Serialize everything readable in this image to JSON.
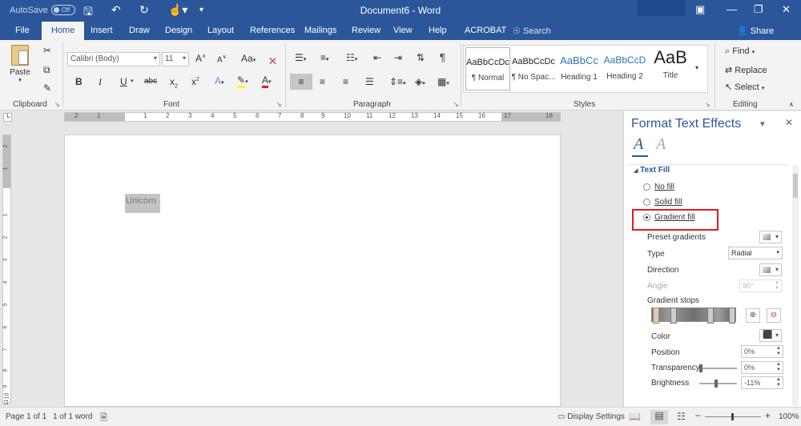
{
  "titlebar": {
    "autosave_label": "AutoSave",
    "autosave_state": "Off",
    "title": "Document6  -  Word",
    "qat_icons": [
      "save-icon",
      "undo-icon",
      "redo-icon",
      "touch-mode-icon",
      "customize-qat-icon"
    ]
  },
  "tabs": [
    "File",
    "Home",
    "Insert",
    "Draw",
    "Design",
    "Layout",
    "References",
    "Mailings",
    "Review",
    "View",
    "Help",
    "ACROBAT"
  ],
  "active_tab": "Home",
  "search_label": "Search",
  "share_label": "Share",
  "clipboard": {
    "paste": "Paste",
    "group": "Clipboard"
  },
  "font": {
    "name": "Calibri (Body)",
    "size": "11",
    "group": "Font",
    "grow": "A",
    "shrink": "A",
    "case": "Aa",
    "bold": "B",
    "italic": "I",
    "underline": "U",
    "strike": "abc",
    "subscript": "x",
    "superscript": "x",
    "effects": "A",
    "color": "A"
  },
  "paragraph": {
    "group": "Paragraph",
    "pilcrow": "¶"
  },
  "styles": {
    "group": "Styles",
    "items": [
      {
        "sample": "AaBbCcDc",
        "name": "¶ Normal"
      },
      {
        "sample": "AaBbCcDc",
        "name": "¶ No Spac..."
      },
      {
        "sample": "AaBbCc",
        "name": "Heading 1"
      },
      {
        "sample": "AaBbCcD",
        "name": "Heading 2"
      },
      {
        "sample": "AaB",
        "name": "Title"
      }
    ]
  },
  "editing": {
    "group": "Editing",
    "find": "Find",
    "replace": "Replace",
    "select": "Select"
  },
  "ruler": {
    "numbers": [
      "2",
      "1",
      "1",
      "2",
      "3",
      "4",
      "5",
      "6",
      "7",
      "8",
      "9",
      "10",
      "11",
      "12",
      "13",
      "14",
      "15",
      "16",
      "17",
      "18"
    ]
  },
  "vruler": {
    "numbers": [
      "2",
      "1",
      "1",
      "2",
      "3",
      "4",
      "5",
      "6",
      "7",
      "8",
      "9",
      "10",
      "11"
    ]
  },
  "document": {
    "text": "Unicorn"
  },
  "pane": {
    "title": "Format Text Effects",
    "section": "Text Fill",
    "fill_options": [
      {
        "label": "No fill",
        "checked": false
      },
      {
        "label": "Solid fill",
        "checked": false
      },
      {
        "label": "Gradient fill",
        "checked": true
      }
    ],
    "preset_gradients": "Preset gradients",
    "type_label": "Type",
    "type_value": "Radial",
    "direction_label": "Direction",
    "angle_label": "Angle",
    "angle_value": "90°",
    "gradient_stops": "Gradient stops",
    "color_label": "Color",
    "position_label": "Position",
    "position_value": "0%",
    "transparency_label": "Transparency",
    "transparency_value": "0%",
    "brightness_label": "Brightness",
    "brightness_value": "-11%"
  },
  "status": {
    "page": "Page 1 of 1",
    "words": "1 of 1 word",
    "display_settings": "Display Settings",
    "zoom": "100%"
  },
  "colors": {
    "accent": "#2b579a",
    "highlight_box": "#e01b24"
  }
}
